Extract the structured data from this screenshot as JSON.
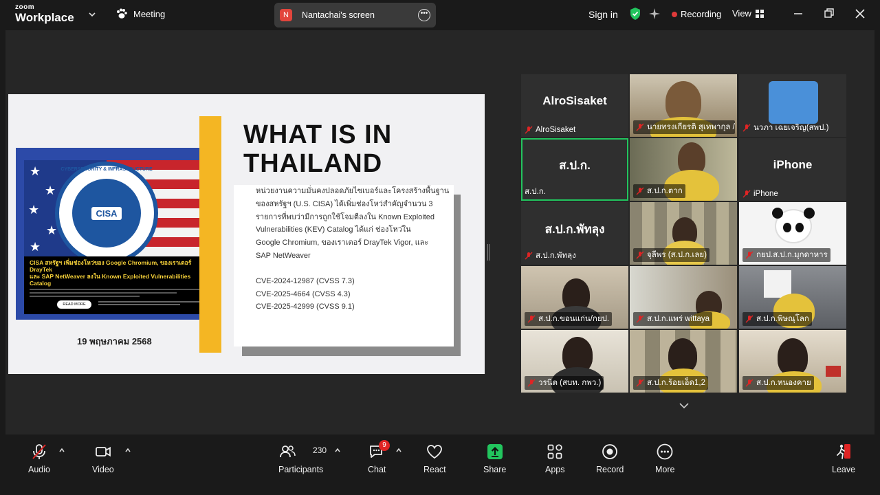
{
  "topbar": {
    "logo_small": "zoom",
    "logo_big": "Workplace",
    "meeting_label": "Meeting",
    "screen_initial": "N",
    "screen_label": "Nantachai's screen",
    "sign_in": "Sign in",
    "recording": "Recording",
    "view": "View"
  },
  "slide": {
    "title_line1": "WHAT IS IN",
    "title_line2": "THAILAND",
    "date": "19 พฤษภาคม 2568",
    "body_lines": [
      "หน่วยงานความมั่นคงปลอดภัยไซเบอร์และโครงสร้างพื้นฐาน",
      "ของสหรัฐฯ (U.S. CISA) ได้เพิ่มช่องโหว่สำคัญจำนวน 3",
      "รายการที่พบว่ามีการถูกใช้โจมตีลงใน Known Exploited",
      "Vulnerabilities (KEV) Catalog ได้แก่ ช่องโหว่ใน",
      "Google Chromium, ของเราเตอร์ DrayTek Vigor, และ",
      "SAP NetWeaver"
    ],
    "cves": [
      "CVE-2024-12987 (CVSS 7.3)",
      "CVE-2025-4664 (CVSS 4.3)",
      "CVE-2025-42999 (CVSS 9.1)"
    ],
    "image": {
      "seal_text": "CYBERSECURITY & INFRASTRUCTURE",
      "seal_badge": "CISA",
      "headline_1": "CISA สหรัฐฯ เพิ่มช่องโหว่ของ Google Chromium, ของเราเตอร์ DrayTek",
      "headline_2": "และ SAP NetWeaver ลงใน Known Exploited Vulnerabilities Catalog",
      "read_more": "READ MORE"
    }
  },
  "participants": [
    {
      "name": "AlroSisaket",
      "big": "AlroSisaket",
      "type": "name"
    },
    {
      "name": "นายทรงเกียรติ สุเทพากุล /...",
      "type": "cam"
    },
    {
      "name": "นวภา เฉยเจริญ(สพป.)",
      "type": "blue"
    },
    {
      "name": "ส.ป.ก.",
      "big": "ส.ป.ก.",
      "type": "name",
      "active": true
    },
    {
      "name": "ส.ป.ก.ตาก",
      "type": "cam"
    },
    {
      "name": "iPhone",
      "big": "iPhone",
      "type": "name"
    },
    {
      "name": "ส.ป.ก.พัทลุง",
      "big": "ส.ป.ก.พัทลุง",
      "type": "name"
    },
    {
      "name": "จุลีพร (ส.ป.ก.เลย)",
      "type": "cam"
    },
    {
      "name": "กยป.ส.ป.ก.มุกดาหาร",
      "type": "panda"
    },
    {
      "name": "ส.ป.ก.ขอนแก่น/กยป.",
      "type": "cam"
    },
    {
      "name": "ส.ป.ก.แพร่ wittaya",
      "type": "cam"
    },
    {
      "name": "ส.ป.ก.พิษณุโลก",
      "type": "cam"
    },
    {
      "name": "วรนิต (สบท. กพว.)",
      "type": "cam"
    },
    {
      "name": "ส.ป.ก.ร้อยเอ็ด1,2",
      "type": "cam"
    },
    {
      "name": "ส.ป.ก.หนองคาย",
      "type": "cam"
    }
  ],
  "toolbar": {
    "audio": "Audio",
    "video": "Video",
    "participants": "Participants",
    "participants_count": "230",
    "chat": "Chat",
    "chat_badge": "9",
    "react": "React",
    "share": "Share",
    "apps": "Apps",
    "record": "Record",
    "more": "More",
    "leave": "Leave"
  },
  "colors": {
    "share_green": "#22c55e",
    "recording_red": "#e03a3a",
    "slide_yellow": "#f4b623"
  }
}
